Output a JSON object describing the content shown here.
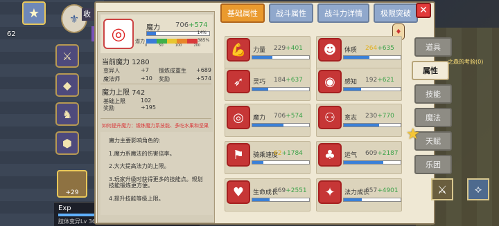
{
  "hud": {
    "avatar_icon": "★",
    "num": "62",
    "collect": "收",
    "emblem_icon": "⚜",
    "exp_label": "Exp",
    "exp_sub": "肢体变异Lv 36",
    "hero_num": "+29"
  },
  "left_icons": [
    "⚔",
    "◆",
    "♞",
    "⬢",
    "⌂"
  ],
  "detail": {
    "icon": "◎",
    "name": "魔力",
    "value": "706",
    "value_plus": "+574",
    "mana_pct": "14%",
    "mana_fill": 0.14,
    "potential_label": "潜力",
    "potential_pct": "385%",
    "potential_ticks": [
      "0",
      "50",
      "100",
      "200"
    ],
    "current_label": "当前魔力 1280",
    "rows1": [
      {
        "k": "变异人",
        "v": "+7"
      },
      {
        "k": "锻炼成重生",
        "v": "+689"
      },
      {
        "k": "魔法师",
        "v": "+10"
      },
      {
        "k": "奖励",
        "v": "+574"
      }
    ],
    "cap_label": "魔力上限 742",
    "rows2": [
      {
        "k": "基础上限",
        "v": "102"
      },
      {
        "k": "奖励",
        "v": "+195"
      }
    ],
    "tip": "如何提升魔力：锻炼魔力系技能、多吃水果和坚果",
    "desc": [
      "魔力主要影响角色的:",
      "1.魔力系魔法的伤害倍率。",
      "2.大大提高法力的上限。",
      "3.玩家升级时获得更多的技能点。规划技能锻炼更方便。",
      "4.提升技能等级上限。"
    ]
  },
  "tabs": [
    "基础属性",
    "战斗属性",
    "战斗力详情",
    "极限突破"
  ],
  "side_tabs": [
    "道具",
    "属性",
    "技能",
    "魔法",
    "天赋",
    "乐团"
  ],
  "map_text": "之森的考验(0)",
  "stats": [
    {
      "icon": "💪",
      "name": "力量",
      "value": "229",
      "plus": "+401",
      "fill": 0.35
    },
    {
      "icon": "☻",
      "name": "体质",
      "value": "264",
      "plus": "+635",
      "fill": 0.45
    },
    {
      "icon": "➶",
      "name": "灵巧",
      "value": "184",
      "plus": "+637",
      "fill": 0.28
    },
    {
      "icon": "◉",
      "name": "感知",
      "value": "192",
      "plus": "+621",
      "fill": 0.3
    },
    {
      "icon": "◎",
      "name": "魔力",
      "value": "706",
      "plus": "+574",
      "fill": 0.55
    },
    {
      "icon": "⚇",
      "name": "意志",
      "value": "230",
      "plus": "+770",
      "fill": 0.62
    },
    {
      "icon": "⚑",
      "name": "骑乘速度",
      "value": "62",
      "plus": "+1784",
      "fill": 0.2
    },
    {
      "icon": "♣",
      "name": "运气",
      "value": "609",
      "plus": "+2187",
      "fill": 0.7
    },
    {
      "icon": "♥",
      "name": "生命成长",
      "value": "669",
      "plus": "+2551",
      "fill": 0.3
    },
    {
      "icon": "✦",
      "name": "法力成长",
      "value": "657",
      "plus": "+4901",
      "fill": 0.32
    }
  ],
  "right_hud": [
    "⚔",
    "⟡"
  ]
}
